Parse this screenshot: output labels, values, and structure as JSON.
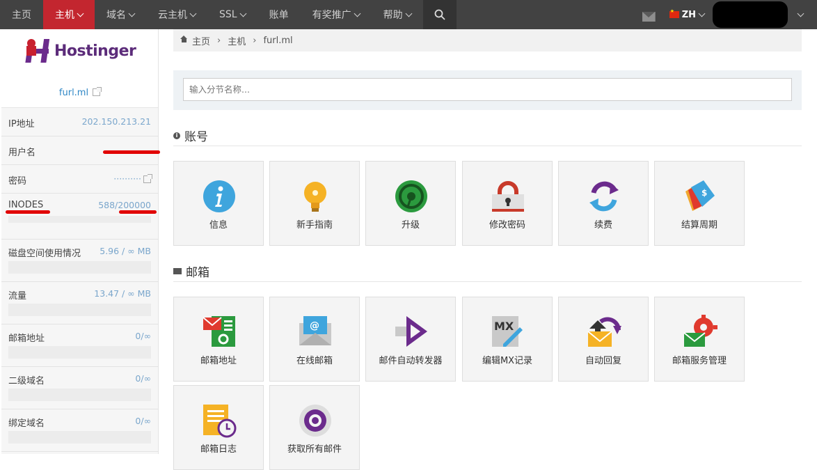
{
  "nav": {
    "items": [
      {
        "label": "主页",
        "caret": false
      },
      {
        "label": "主机",
        "caret": true
      },
      {
        "label": "域名",
        "caret": true
      },
      {
        "label": "云主机",
        "caret": true
      },
      {
        "label": "SSL",
        "caret": true
      },
      {
        "label": "账单",
        "caret": false
      },
      {
        "label": "有奖推广",
        "caret": true
      },
      {
        "label": "帮助",
        "caret": true
      }
    ],
    "lang": "ZH",
    "accent": "#c3262f"
  },
  "sidebar": {
    "logo_text": "Hostinger",
    "domain": "furl.ml",
    "info": [
      {
        "label": "IP地址",
        "value": "202.150.213.21"
      },
      {
        "label": "用户名",
        "value": ""
      },
      {
        "label": "密码",
        "value": "··········"
      }
    ],
    "stats": [
      {
        "label": "INODES",
        "value": "588/200000"
      },
      {
        "label": "磁盘空间使用情况",
        "value": "5.96 / ∞ MB"
      },
      {
        "label": "流量",
        "value": "13.47 / ∞ MB"
      },
      {
        "label": "邮箱地址",
        "value": "0/∞"
      },
      {
        "label": "二级域名",
        "value": "0/∞"
      },
      {
        "label": "绑定域名",
        "value": "0/∞"
      }
    ]
  },
  "breadcrumb": [
    "主页",
    "主机",
    "furl.ml"
  ],
  "search": {
    "placeholder": "输入分节名称..."
  },
  "sections": {
    "account": {
      "title": "账号",
      "tiles": [
        "信息",
        "新手指南",
        "升级",
        "修改密码",
        "续费",
        "结算周期"
      ]
    },
    "email": {
      "title": "邮箱",
      "tiles": [
        "邮箱地址",
        "在线邮箱",
        "邮件自动转发器",
        "编辑MX记录",
        "自动回复",
        "邮箱服务管理",
        "邮箱日志",
        "获取所有邮件"
      ]
    }
  }
}
